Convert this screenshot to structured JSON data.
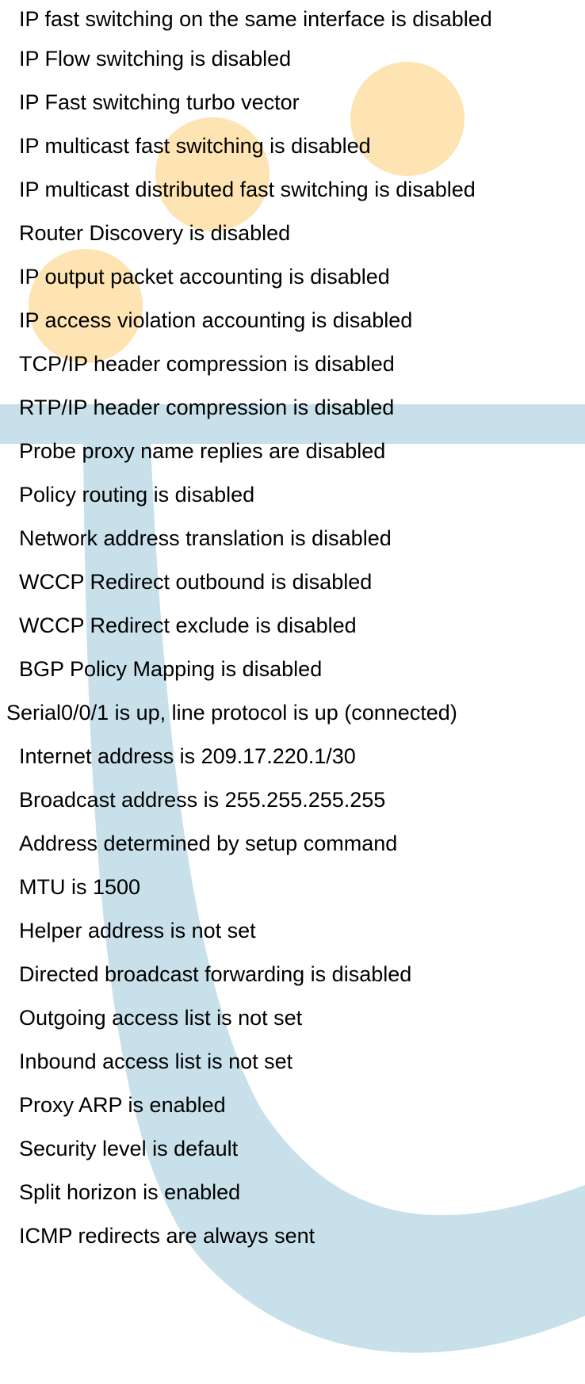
{
  "colors": {
    "background": "#ffffff",
    "text": "#000000",
    "accent_orange": "#fde4b2",
    "accent_blue": "#c8e0ea"
  },
  "lines": [
    "IP fast switching on the same interface is disabled",
    "IP Flow switching is disabled",
    "IP Fast switching turbo vector",
    "IP multicast fast switching is disabled",
    "IP multicast distributed fast switching is disabled",
    "Router Discovery is disabled",
    "IP output packet accounting is disabled",
    "IP access violation accounting is disabled",
    "TCP/IP header compression is disabled",
    "RTP/IP header compression is disabled",
    "Probe proxy name replies are disabled",
    "Policy routing is disabled",
    "Network address translation is disabled",
    "WCCP Redirect outbound is disabled",
    "WCCP Redirect exclude is disabled",
    "BGP Policy Mapping is disabled",
    "Serial0/0/1 is up, line protocol is up (connected)",
    "Internet address is 209.17.220.1/30",
    "Broadcast address is 255.255.255.255",
    "Address determined by setup command",
    "MTU is 1500",
    "Helper address is not set",
    "Directed broadcast forwarding is disabled",
    "Outgoing access list is not set",
    "Inbound  access list is not set",
    "Proxy ARP is enabled",
    "Security level is default",
    "Split horizon is enabled",
    "ICMP redirects are always sent"
  ]
}
